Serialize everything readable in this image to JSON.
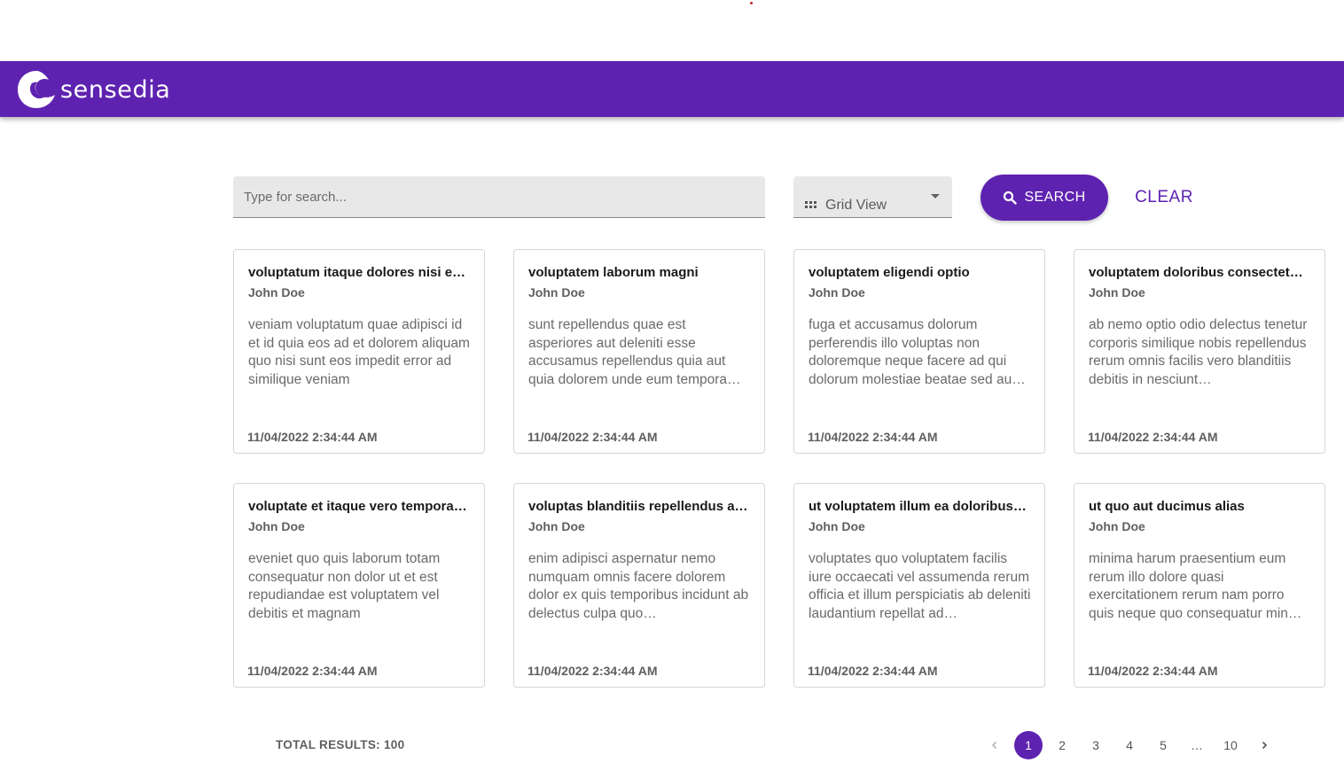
{
  "brand": {
    "name": "sensedia",
    "color": "#5e22b0"
  },
  "search": {
    "placeholder": "Type for search...",
    "value": ""
  },
  "view_select": {
    "selected": "Grid View",
    "icon": "grid-icon"
  },
  "buttons": {
    "search": "SEARCH",
    "clear": "CLEAR"
  },
  "cards": [
    {
      "title": "voluptatum itaque dolores nisi et…",
      "author": "John Doe",
      "body": "veniam voluptatum quae adipisci id et id quia eos ad et dolorem aliquam quo nisi sunt eos impedit error ad similique veniam",
      "date": "11/04/2022 2:34:44 AM"
    },
    {
      "title": "voluptatem laborum magni",
      "author": "John Doe",
      "body": "sunt repellendus quae est asperiores aut deleniti esse accusamus repellendus quia aut quia dolorem unde eum tempora…",
      "date": "11/04/2022 2:34:44 AM"
    },
    {
      "title": "voluptatem eligendi optio",
      "author": "John Doe",
      "body": "fuga et accusamus dolorum perferendis illo voluptas non doloremque neque facere ad qui dolorum molestiae beatae sed au…",
      "date": "11/04/2022 2:34:44 AM"
    },
    {
      "title": "voluptatem doloribus consectetu…",
      "author": "John Doe",
      "body": "ab nemo optio odio delectus tenetur corporis similique nobis repellendus rerum omnis facilis vero blanditiis debitis in nesciunt…",
      "date": "11/04/2022 2:34:44 AM"
    },
    {
      "title": "voluptate et itaque vero tempora …",
      "author": "John Doe",
      "body": "eveniet quo quis laborum totam consequatur non dolor ut et est repudiandae est voluptatem vel debitis et magnam",
      "date": "11/04/2022 2:34:44 AM"
    },
    {
      "title": "voluptas blanditiis repellendus a…",
      "author": "John Doe",
      "body": "enim adipisci aspernatur nemo numquam omnis facere dolorem dolor ex quis temporibus incidunt ab delectus culpa quo…",
      "date": "11/04/2022 2:34:44 AM"
    },
    {
      "title": "ut voluptatem illum ea doloribus …",
      "author": "John Doe",
      "body": "voluptates quo voluptatem facilis iure occaecati vel assumenda rerum officia et illum perspiciatis ab deleniti laudantium repellat ad…",
      "date": "11/04/2022 2:34:44 AM"
    },
    {
      "title": "ut quo aut ducimus alias",
      "author": "John Doe",
      "body": "minima harum praesentium eum rerum illo dolore quasi exercitationem rerum nam porro quis neque quo consequatur min…",
      "date": "11/04/2022 2:34:44 AM"
    }
  ],
  "footer": {
    "total_label": "TOTAL RESULTS: 100"
  },
  "pagination": {
    "current": "1",
    "pages": [
      "1",
      "2",
      "3",
      "4",
      "5",
      "…",
      "10"
    ]
  }
}
